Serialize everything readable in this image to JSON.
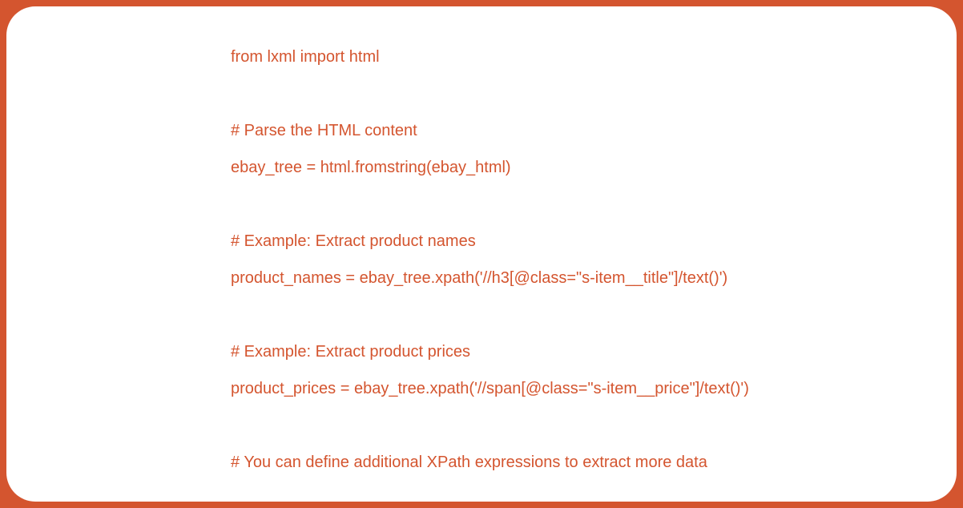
{
  "code": {
    "lines": [
      "from lxml import html",
      "",
      "# Parse the HTML content",
      "ebay_tree = html.fromstring(ebay_html)",
      "",
      "# Example: Extract product names",
      "product_names = ebay_tree.xpath('//h3[@class=\"s-item__title\"]/text()')",
      "",
      "# Example: Extract product prices",
      "product_prices = ebay_tree.xpath('//span[@class=\"s-item__price\"]/text()')",
      "",
      "# You can define additional XPath expressions to extract more data"
    ]
  },
  "colors": {
    "background": "#D4552F",
    "panel": "#FFFFFF",
    "text": "#D4552F"
  }
}
